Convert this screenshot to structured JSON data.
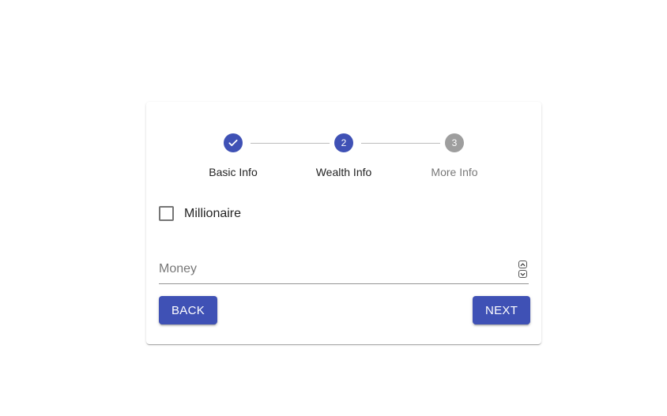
{
  "stepper": {
    "steps": [
      {
        "label": "Basic Info",
        "number": "1",
        "state": "completed",
        "icon": "check-icon"
      },
      {
        "label": "Wealth Info",
        "number": "2",
        "state": "active"
      },
      {
        "label": "More Info",
        "number": "3",
        "state": "pending"
      }
    ]
  },
  "form": {
    "checkbox_label": "Millionaire",
    "checkbox_checked": false,
    "money_placeholder": "Money",
    "money_value": ""
  },
  "actions": {
    "back_label": "BACK",
    "next_label": "NEXT"
  },
  "colors": {
    "primary": "#3f51b5",
    "pending": "#9e9e9e"
  }
}
